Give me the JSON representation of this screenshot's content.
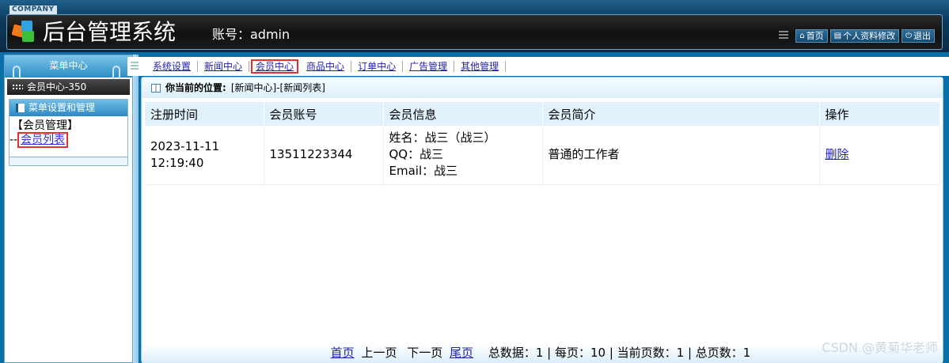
{
  "header": {
    "company": "COMPANY",
    "title": "后台管理系统",
    "account": "账号：admin",
    "links": [
      {
        "icon": "home-icon",
        "label": "首页"
      },
      {
        "icon": "profile-icon",
        "label": "个人资料修改"
      },
      {
        "icon": "power-icon",
        "label": "退出"
      }
    ]
  },
  "sidebar": {
    "menu_center": "菜单中心",
    "member_bar": "会员中心-350",
    "box_title": "菜单设置和管理",
    "group": "【会员管理】",
    "sub_prefix": "--",
    "sub_link": "会员列表"
  },
  "nav": {
    "items": [
      "系统设置",
      "新闻中心",
      "会员中心",
      "商品中心",
      "订单中心",
      "广告管理",
      "其他管理"
    ],
    "active_index": 2
  },
  "location": {
    "label": "你当前的位置:",
    "path": "[新闻中心]-[新闻列表]"
  },
  "table": {
    "headers": [
      "注册时间",
      "会员账号",
      "会员信息",
      "会员简介",
      "操作"
    ],
    "rows": [
      {
        "time_line1": "2023-11-11",
        "time_line2": "12:19:40",
        "account": "13511223344",
        "info_name": "姓名：战三（战三）",
        "info_qq": "QQ：战三",
        "info_email": "Email：战三",
        "intro": "普通的工作者",
        "action": "删除"
      }
    ]
  },
  "pager": {
    "first": "首页",
    "prev": "上一页",
    "next": "下一页",
    "last": "尾页",
    "stats": "总数据：1 | 每页：10 | 当前页数：1 | 总页数：1"
  },
  "watermark": "CSDN @黄菊华老师",
  "colors": {
    "accent": "#0b6fa8",
    "highlight": "#e53030",
    "link": "#2222aa"
  }
}
